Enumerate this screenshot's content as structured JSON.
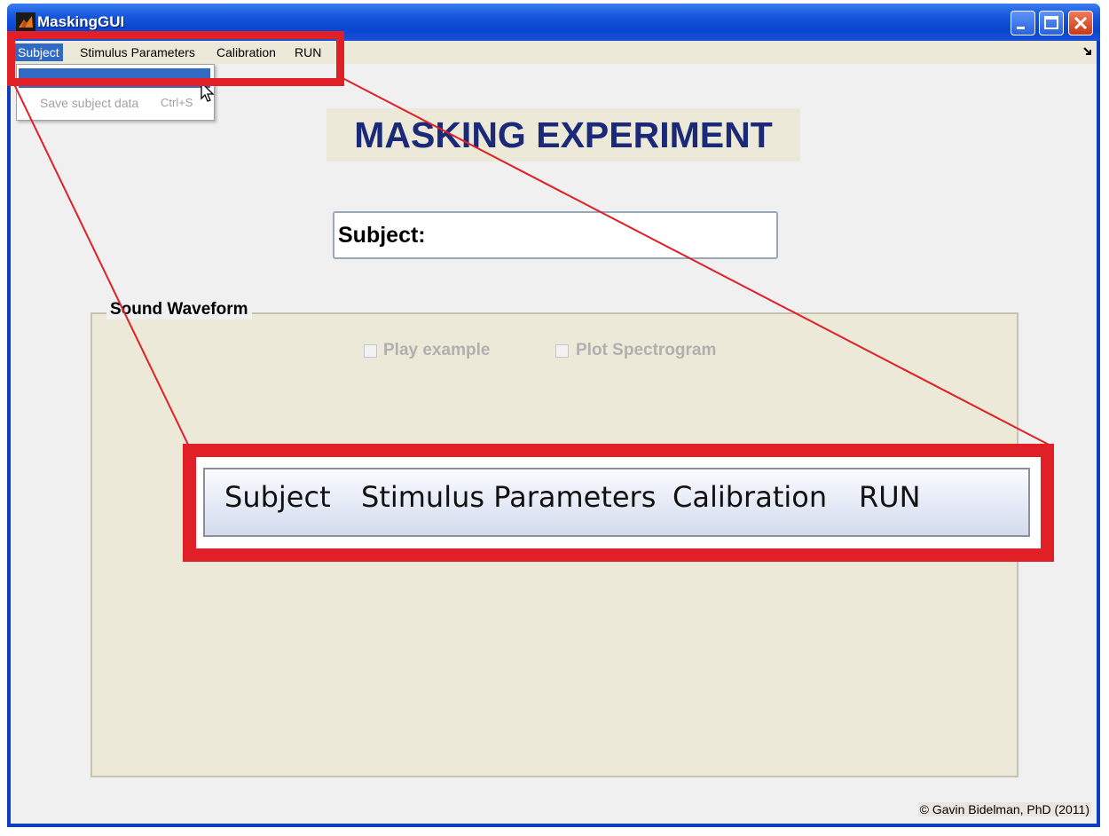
{
  "window": {
    "title": "MaskingGUI",
    "icon": "matlab-icon"
  },
  "menubar": {
    "items": [
      "Subject",
      "Stimulus Parameters",
      "Calibration",
      "RUN"
    ],
    "active_item": "Subject"
  },
  "dropdown": {
    "items": [
      {
        "label": "",
        "highlighted": true
      },
      {
        "label": "Save subject data",
        "shortcut": "Ctrl+S",
        "enabled": false
      }
    ]
  },
  "main": {
    "title": "MASKING EXPERIMENT",
    "subject_label": "Subject:",
    "panel": {
      "legend": "Sound Waveform",
      "checkboxes": [
        {
          "label": "Play example",
          "checked": false,
          "enabled": false
        },
        {
          "label": "Plot Spectrogram",
          "checked": false,
          "enabled": false
        }
      ]
    },
    "footer": "© Gavin Bidelman, PhD (2011)"
  },
  "callout": {
    "items": [
      "Subject",
      "Stimulus Parameters",
      "Calibration",
      "RUN"
    ]
  },
  "colors": {
    "titlebar": "#0a45d0",
    "menu_highlight": "#316ac5",
    "title_text": "#1a2a78",
    "panel_bg": "#ece9d8",
    "callout_red": "#e01f26"
  }
}
